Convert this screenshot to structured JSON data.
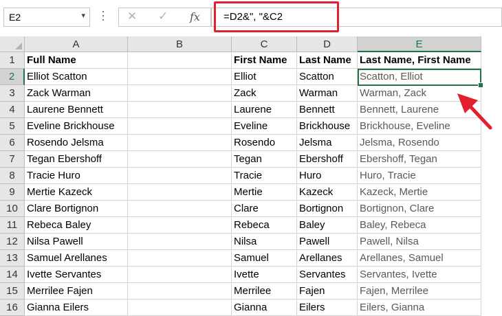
{
  "name_box": {
    "value": "E2",
    "dropdown_icon": "chevron-down-icon"
  },
  "formula_bar": {
    "cancel_icon": "cancel-x-icon",
    "enter_icon": "check-icon",
    "fx_label": "fx",
    "formula": "=D2&\", \"&C2"
  },
  "columns": [
    "A",
    "B",
    "C",
    "D",
    "E"
  ],
  "selected_column": "E",
  "selected_row": "2",
  "rows": [
    {
      "num": "1",
      "a": "Full Name",
      "c": "First Name",
      "d": "Last Name",
      "e": "Last Name, First Name"
    },
    {
      "num": "2",
      "a": "Elliot Scatton",
      "c": "Elliot",
      "d": "Scatton",
      "e": "Scatton, Elliot"
    },
    {
      "num": "3",
      "a": "Zack Warman",
      "c": "Zack",
      "d": "Warman",
      "e": "Warman, Zack"
    },
    {
      "num": "4",
      "a": "Laurene Bennett",
      "c": "Laurene",
      "d": "Bennett",
      "e": "Bennett, Laurene"
    },
    {
      "num": "5",
      "a": "Eveline Brickhouse",
      "c": "Eveline",
      "d": "Brickhouse",
      "e": "Brickhouse, Eveline"
    },
    {
      "num": "6",
      "a": "Rosendo Jelsma",
      "c": "Rosendo",
      "d": "Jelsma",
      "e": "Jelsma, Rosendo"
    },
    {
      "num": "7",
      "a": "Tegan Ebershoff",
      "c": "Tegan",
      "d": "Ebershoff",
      "e": "Ebershoff, Tegan"
    },
    {
      "num": "8",
      "a": "Tracie Huro",
      "c": "Tracie",
      "d": "Huro",
      "e": "Huro, Tracie"
    },
    {
      "num": "9",
      "a": "Mertie Kazeck",
      "c": "Mertie",
      "d": "Kazeck",
      "e": "Kazeck, Mertie"
    },
    {
      "num": "10",
      "a": "Clare Bortignon",
      "c": "Clare",
      "d": "Bortignon",
      "e": "Bortignon, Clare"
    },
    {
      "num": "11",
      "a": "Rebeca Baley",
      "c": "Rebeca",
      "d": "Baley",
      "e": "Baley, Rebeca"
    },
    {
      "num": "12",
      "a": "Nilsa Pawell",
      "c": "Nilsa",
      "d": "Pawell",
      "e": "Pawell, Nilsa"
    },
    {
      "num": "13",
      "a": "Samuel Arellanes",
      "c": "Samuel",
      "d": "Arellanes",
      "e": "Arellanes, Samuel"
    },
    {
      "num": "14",
      "a": "Ivette Servantes",
      "c": "Ivette",
      "d": "Servantes",
      "e": "Servantes, Ivette"
    },
    {
      "num": "15",
      "a": "Merrilee Fajen",
      "c": "Merrilee",
      "d": "Fajen",
      "e": "Fajen, Merrilee"
    },
    {
      "num": "16",
      "a": "Gianna Eilers",
      "c": "Gianna",
      "d": "Eilers",
      "e": "Eilers, Gianna"
    }
  ],
  "colors": {
    "highlight_box": "#e2202d",
    "arrow": "#e2202d",
    "selection": "#217346",
    "header_bg": "#e6e6e6"
  }
}
